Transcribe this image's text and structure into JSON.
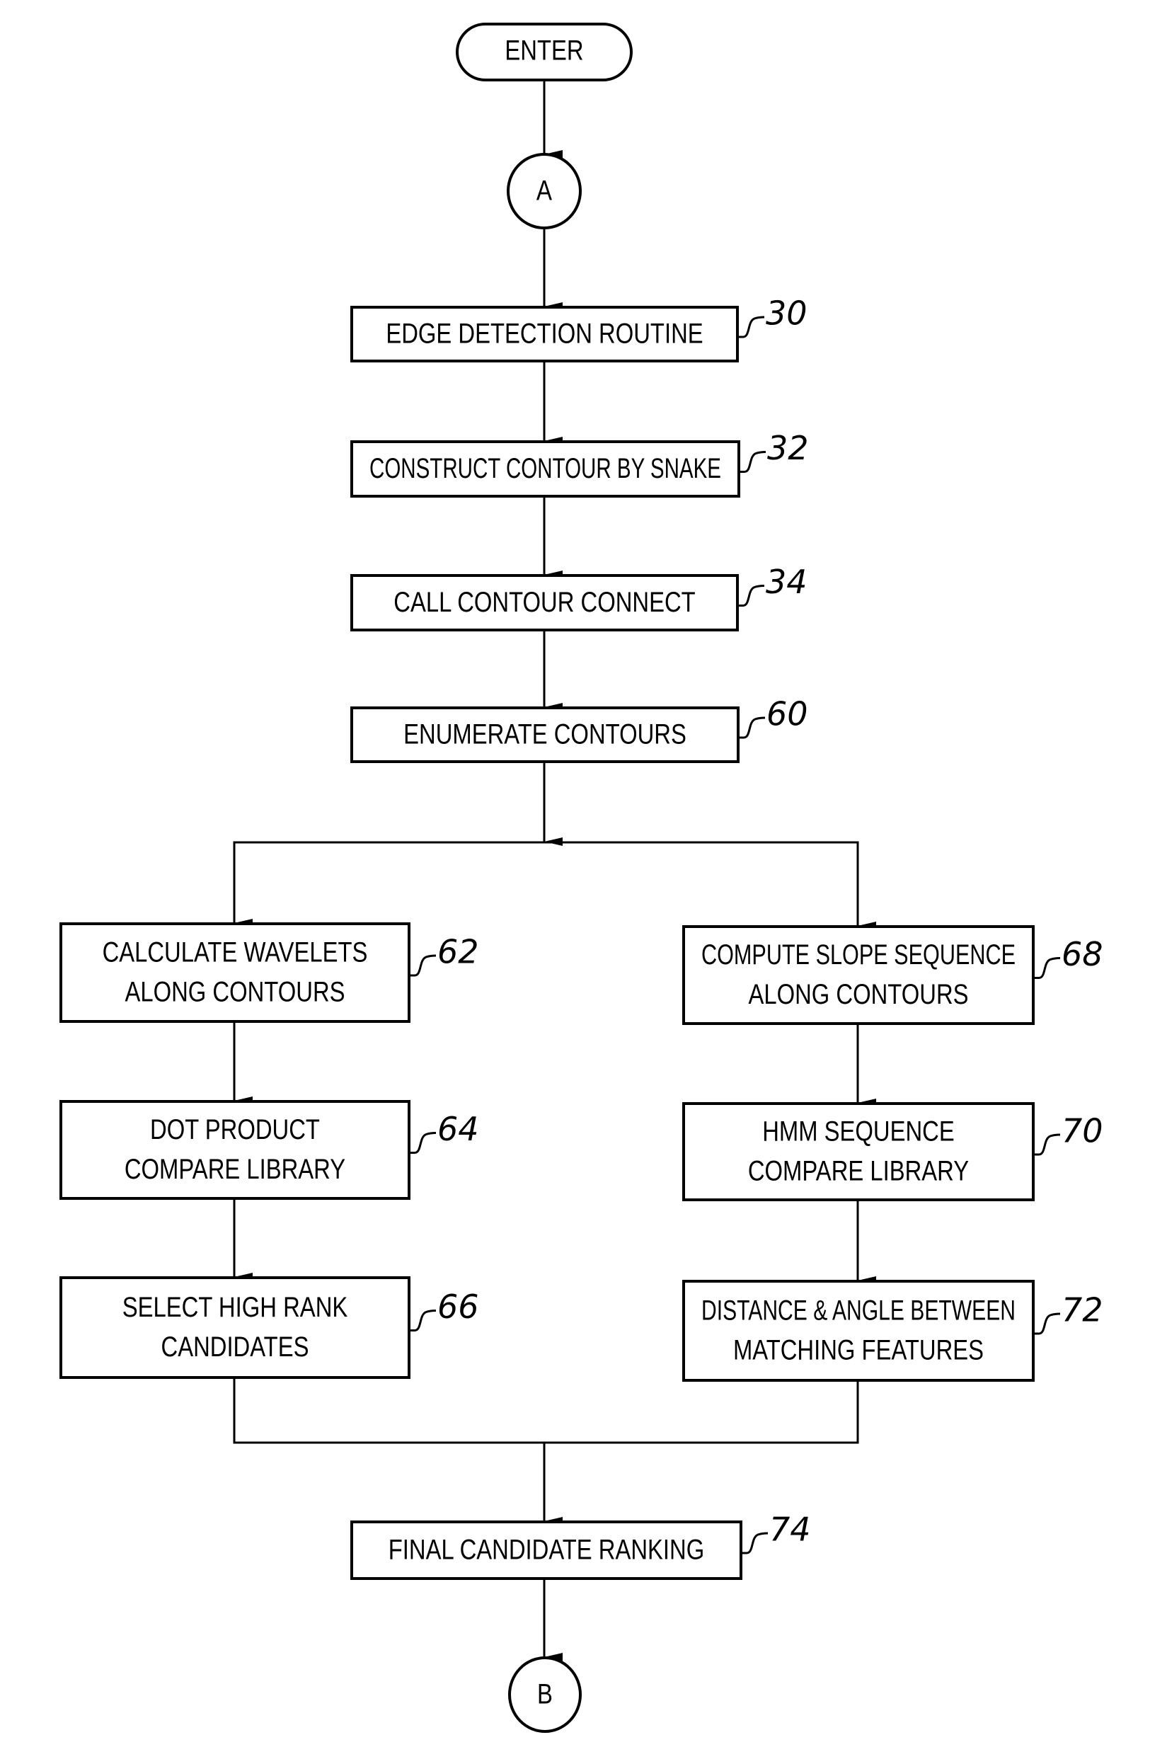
{
  "diagram": {
    "type": "flowchart",
    "terminals": {
      "enter": {
        "label": "ENTER"
      },
      "connector_a": {
        "label": "A"
      },
      "connector_b": {
        "label": "B"
      }
    },
    "steps": {
      "s30": {
        "ref": "30",
        "lines": [
          "EDGE DETECTION ROUTINE"
        ]
      },
      "s32": {
        "ref": "32",
        "lines": [
          "CONSTRUCT CONTOUR BY SNAKE"
        ]
      },
      "s34": {
        "ref": "34",
        "lines": [
          "CALL CONTOUR CONNECT"
        ]
      },
      "s60": {
        "ref": "60",
        "lines": [
          "ENUMERATE CONTOURS"
        ]
      },
      "s62": {
        "ref": "62",
        "lines": [
          "CALCULATE WAVELETS",
          "ALONG CONTOURS"
        ]
      },
      "s64": {
        "ref": "64",
        "lines": [
          "DOT PRODUCT",
          "COMPARE LIBRARY"
        ]
      },
      "s66": {
        "ref": "66",
        "lines": [
          "SELECT HIGH RANK",
          "CANDIDATES"
        ]
      },
      "s68": {
        "ref": "68",
        "lines": [
          "COMPUTE SLOPE SEQUENCE",
          "ALONG CONTOURS"
        ]
      },
      "s70": {
        "ref": "70",
        "lines": [
          "HMM SEQUENCE",
          "COMPARE LIBRARY"
        ]
      },
      "s72": {
        "ref": "72",
        "lines": [
          "DISTANCE & ANGLE BETWEEN",
          "MATCHING FEATURES"
        ]
      },
      "s74": {
        "ref": "74",
        "lines": [
          "FINAL CANDIDATE RANKING"
        ]
      }
    },
    "flow": [
      [
        "enter",
        "connector_a"
      ],
      [
        "connector_a",
        "s30"
      ],
      [
        "s30",
        "s32"
      ],
      [
        "s32",
        "s34"
      ],
      [
        "s34",
        "s60"
      ],
      [
        "s60",
        "s62"
      ],
      [
        "s60",
        "s68"
      ],
      [
        "s62",
        "s64"
      ],
      [
        "s64",
        "s66"
      ],
      [
        "s68",
        "s70"
      ],
      [
        "s70",
        "s72"
      ],
      [
        "s66",
        "s74"
      ],
      [
        "s72",
        "s74"
      ],
      [
        "s74",
        "connector_b"
      ]
    ]
  }
}
